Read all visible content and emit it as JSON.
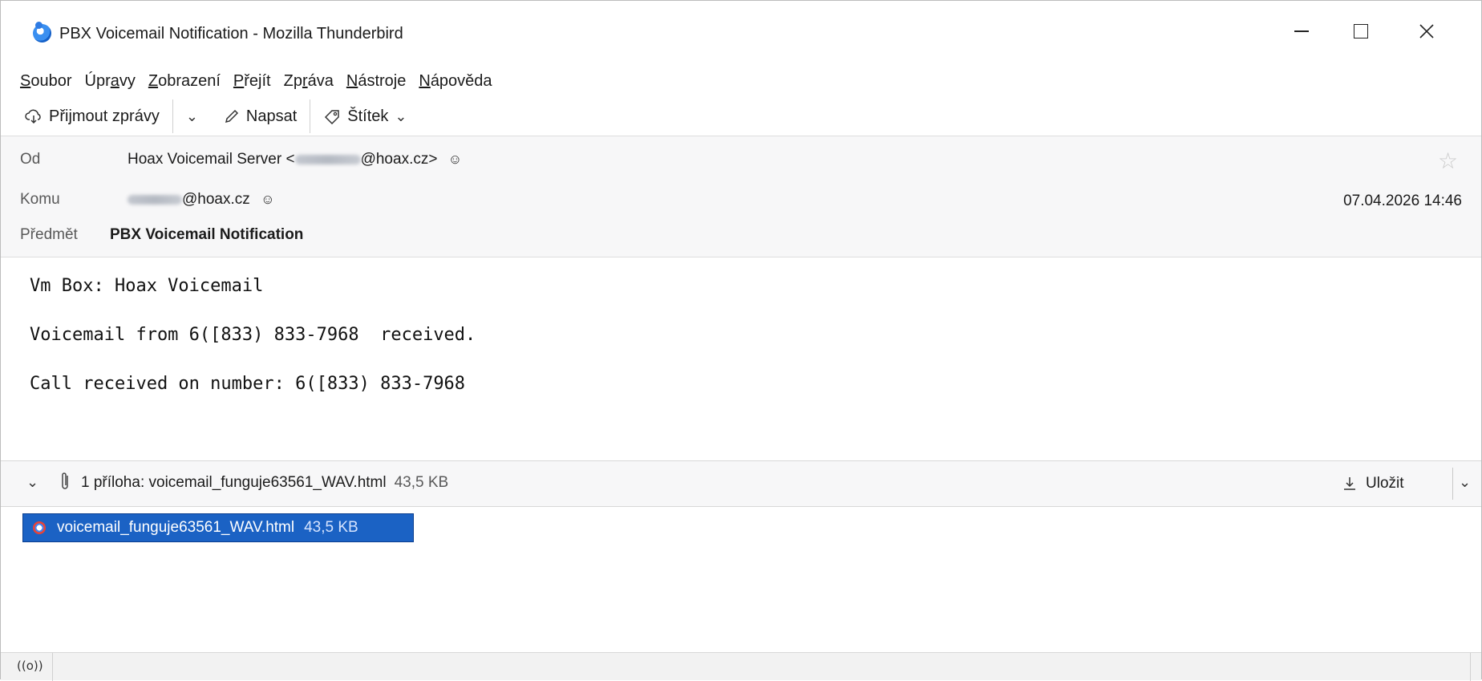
{
  "window": {
    "title": "PBX Voicemail Notification - Mozilla Thunderbird",
    "controls": {
      "minimize": "minimize",
      "maximize": "maximize",
      "close": "close"
    }
  },
  "menubar": {
    "items": [
      {
        "pre": "",
        "key": "S",
        "post": "oubor"
      },
      {
        "pre": "Úpr",
        "key": "a",
        "post": "vy"
      },
      {
        "pre": "",
        "key": "Z",
        "post": "obrazení"
      },
      {
        "pre": "",
        "key": "P",
        "post": "řejít"
      },
      {
        "pre": "Zp",
        "key": "r",
        "post": "áva"
      },
      {
        "pre": "",
        "key": "N",
        "post": "ástroje"
      },
      {
        "pre": "",
        "key": "N",
        "post": "ápověda"
      }
    ]
  },
  "toolbar": {
    "get_messages": "Přijmout zprávy",
    "compose": "Napsat",
    "tag": "Štítek"
  },
  "header": {
    "from_label": "Od",
    "from_name_prefix": "Hoax Voicemail Server <",
    "from_domain": "@hoax.cz>",
    "to_label": "Komu",
    "to_domain": "@hoax.cz",
    "subject_label": "Předmět",
    "subject": "PBX Voicemail Notification",
    "date": "07.04.2026 14:46"
  },
  "body": {
    "lines": [
      "Vm Box: Hoax Voicemail",
      "Voicemail from 6([833) 833-7968  received.",
      "Call received on number: 6([833) 833-7968"
    ]
  },
  "attachments": {
    "summary": "1 příloha: voicemail_funguje63561_WAV.html",
    "summary_size": "43,5 KB",
    "save_label": "Uložit",
    "items": [
      {
        "name": "voicemail_funguje63561_WAV.html",
        "size": "43,5 KB"
      }
    ]
  },
  "statusbar": {
    "icon": "((o))"
  },
  "colors": {
    "selection": "#1b62c4",
    "header_bg": "#f7f7f8"
  }
}
